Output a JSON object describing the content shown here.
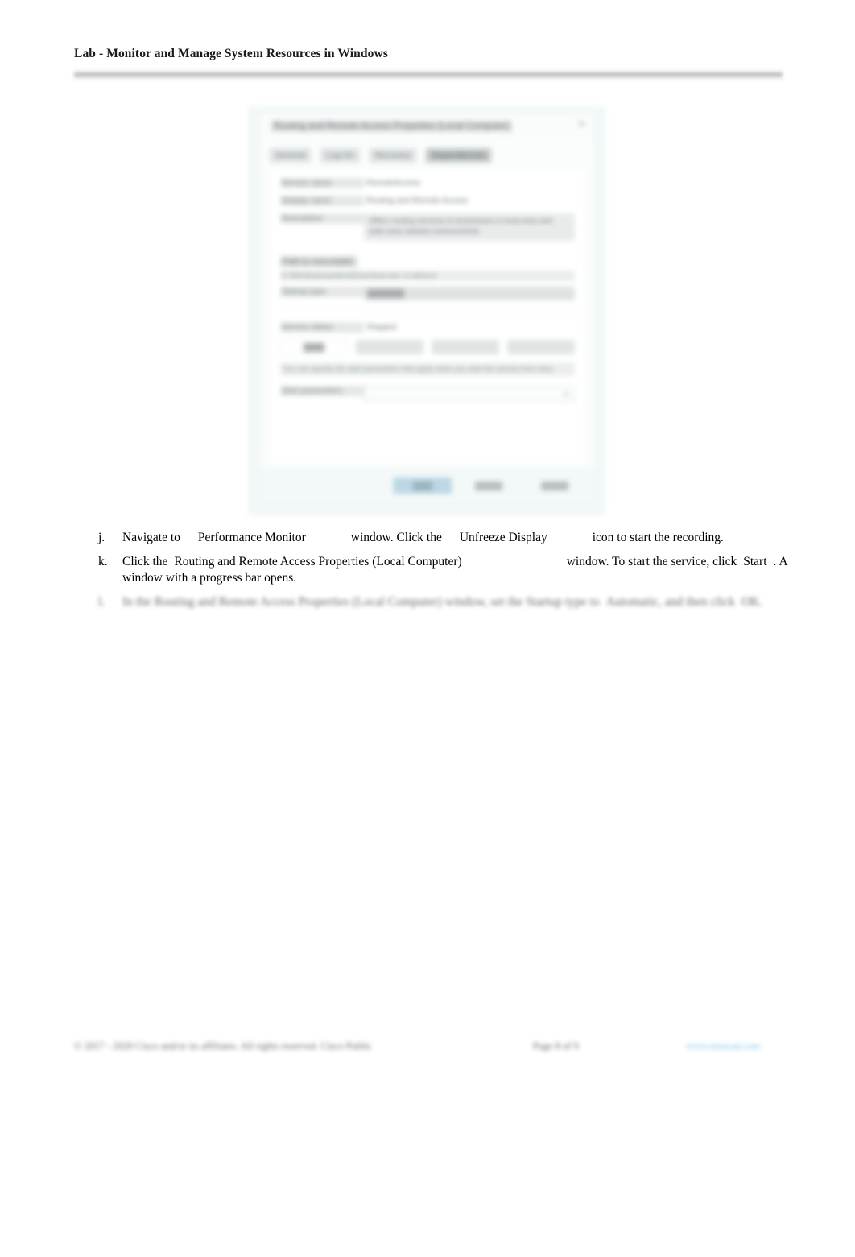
{
  "document": {
    "header_title": "Lab - Monitor and Manage System Resources in Windows"
  },
  "figure": {
    "dialog": {
      "title": "Routing and Remote Access Properties (Local Computer)",
      "close_icon": "close-icon",
      "tabs": [
        {
          "label": "General"
        },
        {
          "label": "Log On"
        },
        {
          "label": "Recovery"
        },
        {
          "label": "Dependencies"
        }
      ],
      "active_tab": "Dependencies",
      "fields": {
        "service_name_label": "Service name:",
        "service_name_value": "RemoteAccess",
        "display_name_label": "Display name:",
        "display_name_value": "Routing and Remote Access",
        "description_label": "Description:",
        "description_value": "Offers routing services to businesses in local area and wide area network environments.",
        "path_label": "Path to executable:",
        "path_value": "C:\\Windows\\system32\\svchost.exe -k netsvcs",
        "startup_type_label": "Startup type:",
        "startup_type_value": "Manual"
      },
      "service_section": {
        "status_label": "Service status:",
        "status_value": "Stopped",
        "buttons": [
          {
            "label": "Start"
          },
          {
            "label": "Stop"
          },
          {
            "label": "Pause"
          },
          {
            "label": "Resume"
          }
        ],
        "note": "You can specify the start parameters that apply when you start the service from here."
      },
      "start_parameters": {
        "label": "Start parameters:",
        "value": ""
      },
      "footer_buttons": [
        {
          "label": "OK",
          "style": "primary"
        },
        {
          "label": "Cancel",
          "style": "secondary"
        },
        {
          "label": "Apply",
          "style": "secondary"
        }
      ]
    }
  },
  "instructions": [
    {
      "marker": "j.",
      "part1": "Navigate to",
      "bold1": "Performance Monitor",
      "part2": "window. Click the",
      "bold2": "Unfreeze Display",
      "part3": "icon to start the recording."
    },
    {
      "marker": "k.",
      "part1": "Click the",
      "bold1": "Routing and Remote Access Properties (Local Computer)",
      "part2": "window. To start the service, click",
      "bold2": "Start",
      "part3": ". A window with a progress bar opens."
    },
    {
      "marker": "l.",
      "part1": "In the Routing and Remote Access Properties (Local Computer) window, set the Startup type to",
      "bold1": "Automatic",
      "part2": ", and then click",
      "bold2": "OK",
      "part3": "."
    }
  ],
  "footer": {
    "copyright": "© 2017 - 2020 Cisco and/or its affiliates. All rights reserved. Cisco Public",
    "page_number": "Page 8 of 9",
    "link_text": "www.netacad.com"
  }
}
